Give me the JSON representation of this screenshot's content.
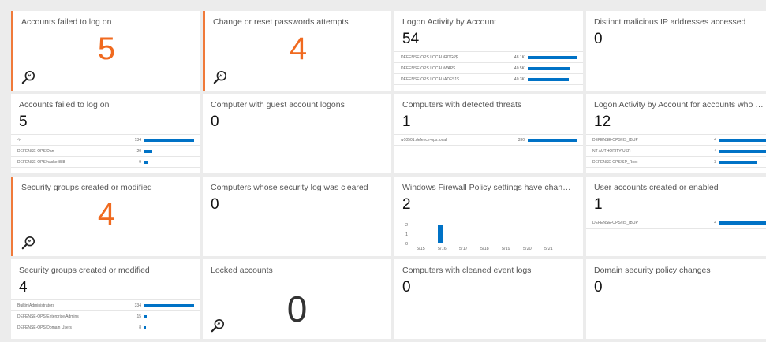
{
  "tiles": [
    {
      "title": "Accounts failed to log on",
      "value": "5",
      "style": "big",
      "accent": true
    },
    {
      "title": "Change or reset passwords attempts",
      "value": "4",
      "style": "big",
      "accent": true
    },
    {
      "title": "Logon Activity by Account",
      "value": "54",
      "style": "list",
      "rows": [
        {
          "label": "DEFENSE-OPS.LOCAL\\ROG6$",
          "value": "48.1K",
          "fraction": 0.98
        },
        {
          "label": "DEFENSE-OPS.LOCAL\\WAP$",
          "value": "40.5K",
          "fraction": 0.83
        },
        {
          "label": "DEFENSE-OPS.LOCAL\\ADFS1$",
          "value": "40.3K",
          "fraction": 0.82
        }
      ]
    },
    {
      "title": "Distinct malicious IP addresses accessed",
      "value": "0",
      "style": "plain"
    },
    {
      "title": "Accounts failed to log on",
      "value": "5",
      "style": "list",
      "rows": [
        {
          "label": "-\\-",
          "value": "134",
          "fraction": 0.98
        },
        {
          "label": "DEFENSE-OPS\\Dan",
          "value": "20",
          "fraction": 0.15
        },
        {
          "label": "DEFENSE-OPS\\hacker888",
          "value": "9",
          "fraction": 0.07
        }
      ]
    },
    {
      "title": "Computer with guest account logons",
      "value": "0",
      "style": "plain"
    },
    {
      "title": "Computers with detected threats",
      "value": "1",
      "style": "list",
      "rows": [
        {
          "label": "w10501.defence-ops.local",
          "value": "330",
          "fraction": 0.98
        }
      ]
    },
    {
      "title": "Logon Activity by Account for accounts who only...",
      "value": "12",
      "style": "list",
      "rows": [
        {
          "label": "DEFENSE-OPS\\IIS_IBUP",
          "value": "4",
          "fraction": 1.0
        },
        {
          "label": "NT AUTHORITY\\USR",
          "value": "4",
          "fraction": 1.0
        },
        {
          "label": "DEFENSE-OPS\\SP_Root",
          "value": "3",
          "fraction": 0.75
        }
      ]
    },
    {
      "title": "Security groups created or modified",
      "value": "4",
      "style": "big",
      "accent": true
    },
    {
      "title": "Computers whose security log was cleared",
      "value": "0",
      "style": "plain"
    },
    {
      "title": "Windows Firewall Policy settings have changed",
      "value": "2",
      "style": "chart"
    },
    {
      "title": "User accounts created or enabled",
      "value": "1",
      "style": "list",
      "rows": [
        {
          "label": "DEFENSE-OPS\\IIS_IBUP",
          "value": "4",
          "fraction": 1.0
        }
      ]
    },
    {
      "title": "Security groups created or modified",
      "value": "4",
      "style": "list",
      "rows": [
        {
          "label": "Builtin\\Administrators",
          "value": "334",
          "fraction": 0.98
        },
        {
          "label": "DEFENSE-OPS\\Enterprise Admins",
          "value": "15",
          "fraction": 0.05
        },
        {
          "label": "DEFENSE-OPS\\Domain Users",
          "value": "8",
          "fraction": 0.03
        }
      ]
    },
    {
      "title": "Locked accounts",
      "value": "0",
      "style": "bigdark"
    },
    {
      "title": "Computers with cleaned event logs",
      "value": "0",
      "style": "plain"
    },
    {
      "title": "Domain security policy changes",
      "value": "0",
      "style": "plain"
    }
  ],
  "chart_data": {
    "type": "bar",
    "categories": [
      "5/15",
      "5/16",
      "5/17",
      "5/18",
      "5/19",
      "5/20",
      "5/21"
    ],
    "values": [
      0,
      2,
      0,
      0,
      0,
      0,
      0
    ],
    "yticks": [
      "0",
      "1",
      "2"
    ],
    "ylim": [
      0,
      2
    ],
    "color": "#0072c6"
  },
  "icons": {
    "magnifier": "search-icon"
  },
  "colors": {
    "accent": "#f07a3a",
    "bar": "#0072c6"
  }
}
